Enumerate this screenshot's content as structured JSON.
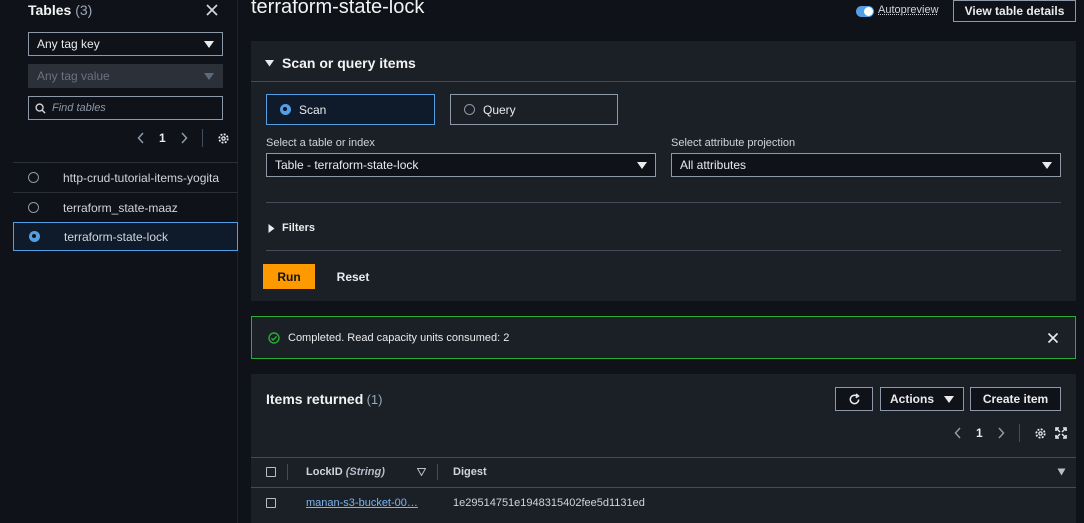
{
  "sidebar": {
    "title": "Tables",
    "count": "(3)",
    "tag_key": "Any tag key",
    "tag_value": "Any tag value",
    "search_placeholder": "Find tables",
    "page": "1",
    "tables": [
      {
        "name": "http-crud-tutorial-items-yogita",
        "selected": false
      },
      {
        "name": "terraform_state-maaz",
        "selected": false
      },
      {
        "name": "terraform-state-lock",
        "selected": true
      }
    ]
  },
  "header": {
    "title": "terraform-state-lock",
    "autopreview_label": "Autopreview",
    "autopreview_on": true,
    "view_details_label": "View table details"
  },
  "scan_panel": {
    "title": "Scan or query items",
    "scan_label": "Scan",
    "query_label": "Query",
    "table_index_label": "Select a table or index",
    "table_index_value": "Table - terraform-state-lock",
    "projection_label": "Select attribute projection",
    "projection_value": "All attributes",
    "filters_label": "Filters",
    "run_label": "Run",
    "reset_label": "Reset"
  },
  "flash": {
    "message": "Completed. Read capacity units consumed: 2"
  },
  "items": {
    "title": "Items returned",
    "count": "(1)",
    "actions_label": "Actions",
    "create_label": "Create item",
    "page": "1",
    "columns": [
      "LockID",
      "(String)",
      "Digest"
    ],
    "rows": [
      {
        "lockid": "manan-s3-bucket-00…",
        "digest": "1e29514751e1948315402fee5d1131ed"
      }
    ]
  },
  "colors": {
    "accent": "#539fe5",
    "primary_button": "#ff9900",
    "success": "#29ad32"
  }
}
